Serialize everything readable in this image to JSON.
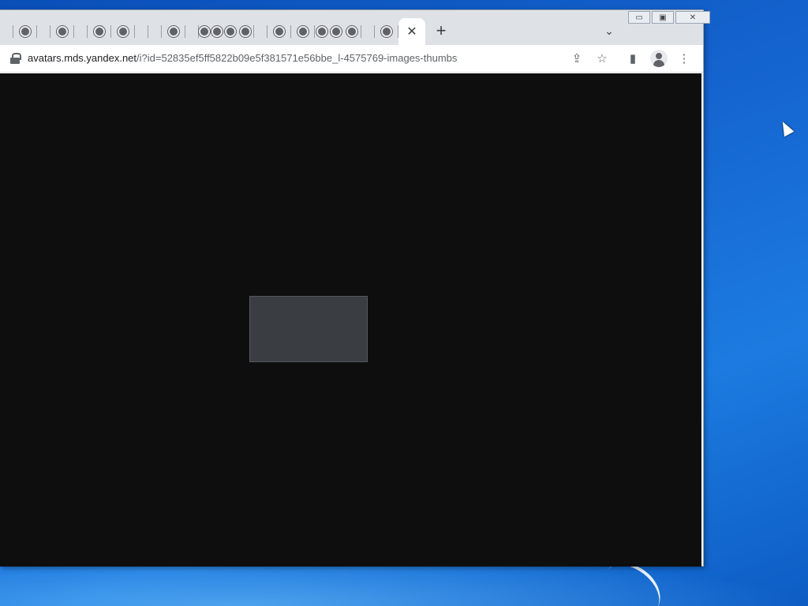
{
  "browser": {
    "tab_count_visual": 24,
    "active_tab_close": "✕",
    "new_tab": "+",
    "tab_search": "⌄",
    "window_controls": {
      "minimize": "▭",
      "maximize": "▣",
      "close": "✕"
    },
    "address": {
      "host": "avatars.mds.yandex.net",
      "path": "/i?id=52835ef5ff5822b09e5f381571e56bbe_l-4575769-images-thumbs"
    },
    "toolbar_icons": [
      "share-icon",
      "bookmark-star-icon",
      "side-panel-icon",
      "profile-icon",
      "menu-icon"
    ]
  },
  "page": {
    "background": "#0e0e0f",
    "image_placeholder_label": ""
  },
  "colors": {
    "desktop": "#1565d0",
    "tabstrip": "#dee1e6"
  }
}
